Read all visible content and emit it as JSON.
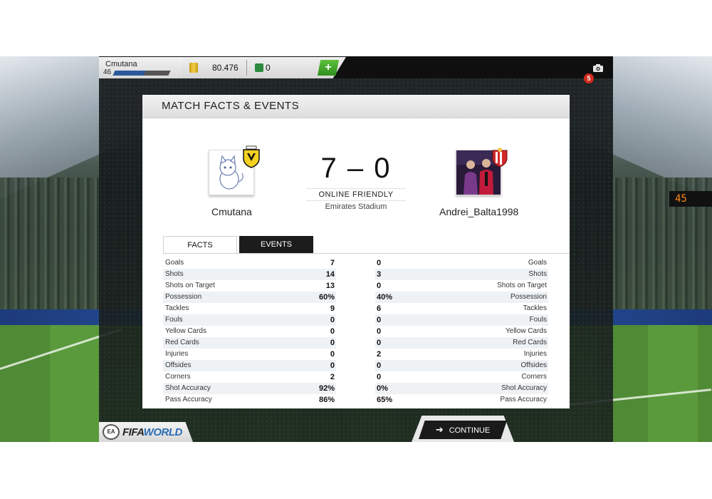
{
  "topbar": {
    "username": "Cmutana",
    "level": "46",
    "level_progress": 0.55,
    "coins": "80.476",
    "points": "0",
    "plus_label": "+",
    "notifications": "5"
  },
  "panel": {
    "title": "MATCH FACTS & EVENTS"
  },
  "match": {
    "home_name": "Cmutana",
    "away_name": "Andrei_Balta1998",
    "score": "7 – 0",
    "type": "ONLINE FRIENDLY",
    "venue": "Emirates Stadium"
  },
  "tabs": {
    "facts": "FACTS",
    "events": "EVENTS"
  },
  "stats": {
    "home": [
      {
        "label": "Goals",
        "value": "7"
      },
      {
        "label": "Shots",
        "value": "14"
      },
      {
        "label": "Shots on Target",
        "value": "13"
      },
      {
        "label": "Possession",
        "value": "60%"
      },
      {
        "label": "Tackles",
        "value": "9"
      },
      {
        "label": "Fouls",
        "value": "0"
      },
      {
        "label": "Yellow Cards",
        "value": "0"
      },
      {
        "label": "Red Cards",
        "value": "0"
      },
      {
        "label": "Injuries",
        "value": "0"
      },
      {
        "label": "Offsides",
        "value": "0"
      },
      {
        "label": "Corners",
        "value": "2"
      },
      {
        "label": "Shot Accuracy",
        "value": "92%"
      },
      {
        "label": "Pass Accuracy",
        "value": "86%"
      }
    ],
    "away": [
      {
        "label": "Goals",
        "value": "0"
      },
      {
        "label": "Shots",
        "value": "3"
      },
      {
        "label": "Shots on Target",
        "value": "0"
      },
      {
        "label": "Possession",
        "value": "40%"
      },
      {
        "label": "Tackles",
        "value": "6"
      },
      {
        "label": "Fouls",
        "value": "0"
      },
      {
        "label": "Yellow Cards",
        "value": "0"
      },
      {
        "label": "Red Cards",
        "value": "0"
      },
      {
        "label": "Injuries",
        "value": "2"
      },
      {
        "label": "Offsides",
        "value": "0"
      },
      {
        "label": "Corners",
        "value": "0"
      },
      {
        "label": "Shot Accuracy",
        "value": "0%"
      },
      {
        "label": "Pass Accuracy",
        "value": "65%"
      }
    ]
  },
  "footer": {
    "ea_label": "EA",
    "fifa_label": "FIFA",
    "world_label": "WORLD",
    "continue_label": "CONTINUE"
  },
  "background": {
    "scoreboard": "45"
  }
}
